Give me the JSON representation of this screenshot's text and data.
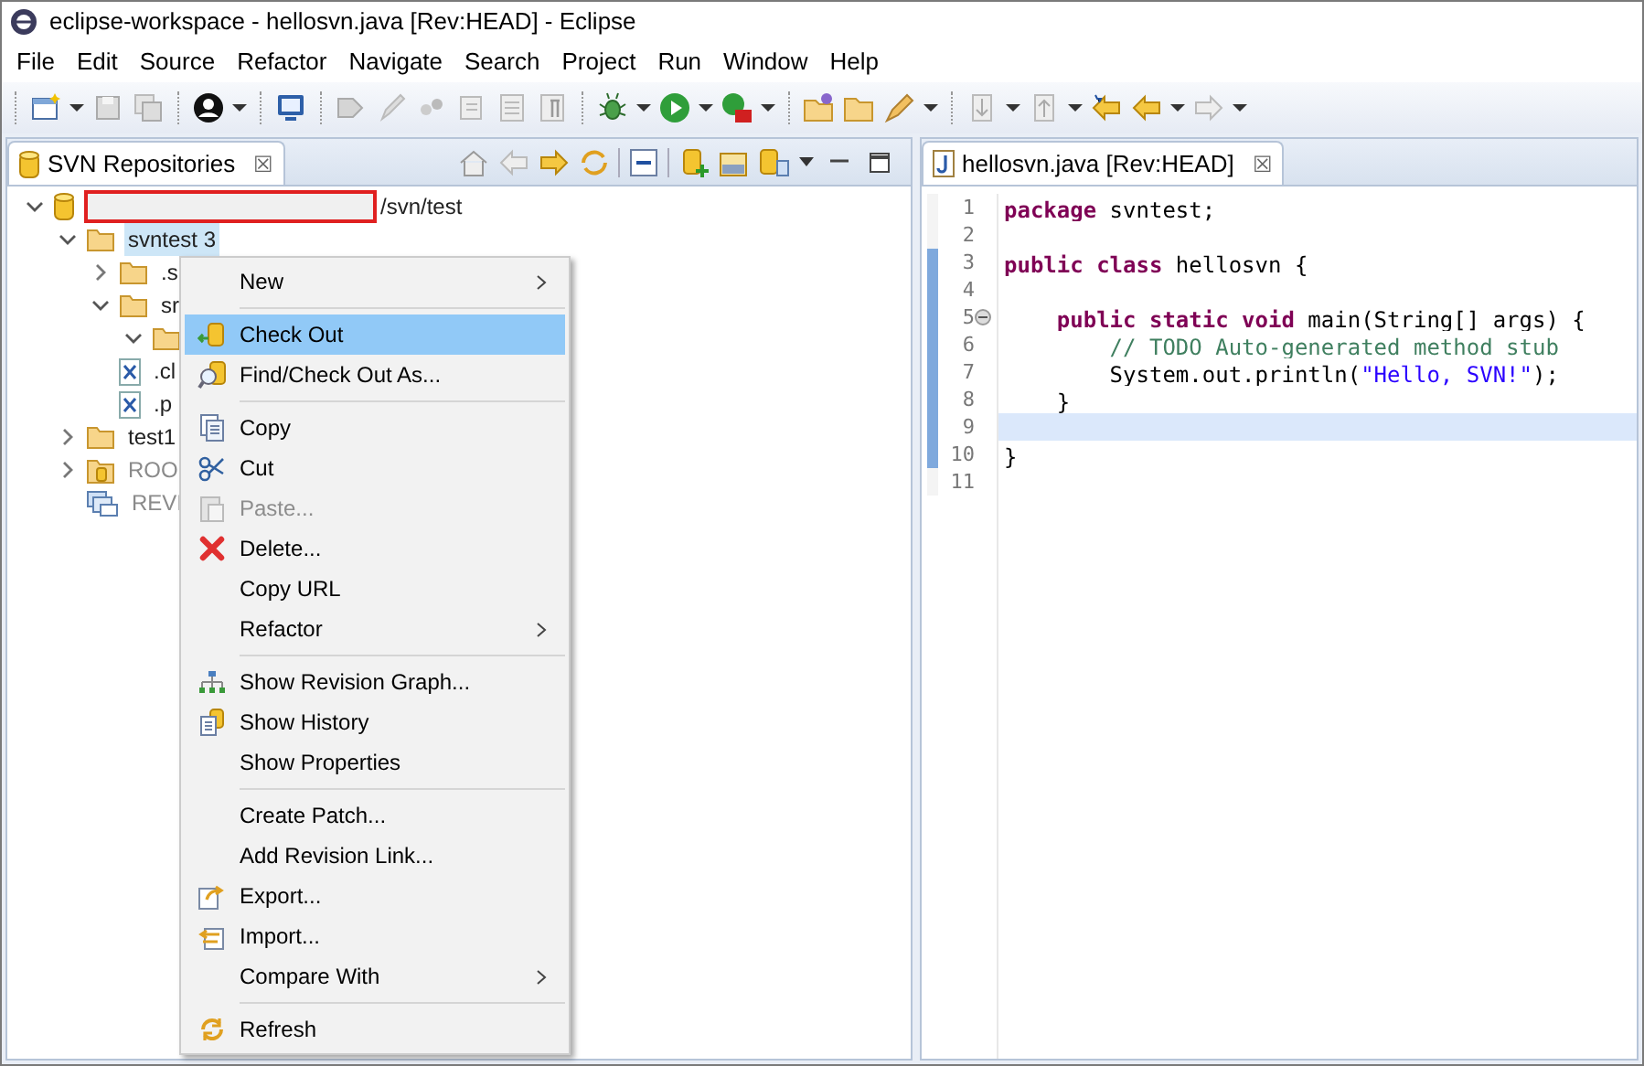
{
  "window": {
    "title": "eclipse-workspace - hellosvn.java [Rev:HEAD] - Eclipse"
  },
  "menu_bar": [
    "File",
    "Edit",
    "Source",
    "Refactor",
    "Navigate",
    "Search",
    "Project",
    "Run",
    "Window",
    "Help"
  ],
  "repositories_view": {
    "tab": {
      "label": "SVN Repositories",
      "selected": true,
      "close": "☒"
    },
    "tree": [
      {
        "kind": "repository",
        "label": "/svn/test",
        "expanded": true,
        "disabled": false,
        "children": [
          {
            "kind": "folder",
            "label": "svntest 3",
            "expanded": true,
            "selected": true,
            "disabled": false,
            "children": [
              {
                "kind": "folder",
                "label": ".s",
                "expanded": false,
                "selected": false,
                "disabled": false
              },
              {
                "kind": "folder",
                "label": "sr",
                "expanded": true,
                "selected": false,
                "disabled": false,
                "children": [
                  {
                    "kind": "folder",
                    "expanded": true
                  }
                ]
              },
              {
                "kind": "file",
                "label": ".cl",
                "selected": false,
                "disabled": false
              },
              {
                "kind": "file",
                "label": ".p",
                "selected": false,
                "disabled": false
              }
            ]
          },
          {
            "kind": "folder",
            "label": "test1",
            "expanded": false,
            "selected": false,
            "disabled": false
          },
          {
            "kind": "root",
            "label": "ROO",
            "expanded": false,
            "selected": false,
            "disabled": true
          },
          {
            "kind": "revisions",
            "label": "REVI",
            "selected": false,
            "disabled": true
          }
        ]
      }
    ]
  },
  "context_menu": [
    {
      "kind": "item",
      "label": "New",
      "submenu": true,
      "selected": false,
      "disabled": false
    },
    {
      "kind": "separator"
    },
    {
      "kind": "item",
      "label": "Check Out",
      "submenu": false,
      "selected": true,
      "disabled": false
    },
    {
      "kind": "item",
      "label": "Find/Check Out As...",
      "submenu": false,
      "selected": false,
      "disabled": false
    },
    {
      "kind": "separator"
    },
    {
      "kind": "item",
      "label": "Copy",
      "submenu": false,
      "selected": false,
      "disabled": false
    },
    {
      "kind": "item",
      "label": "Cut",
      "submenu": false,
      "selected": false,
      "disabled": false
    },
    {
      "kind": "item",
      "label": "Paste...",
      "submenu": false,
      "selected": false,
      "disabled": true
    },
    {
      "kind": "item",
      "label": "Delete...",
      "submenu": false,
      "selected": false,
      "disabled": false
    },
    {
      "kind": "item",
      "label": "Copy URL",
      "submenu": false,
      "selected": false,
      "disabled": false
    },
    {
      "kind": "item",
      "label": "Refactor",
      "submenu": true,
      "selected": false,
      "disabled": false
    },
    {
      "kind": "separator"
    },
    {
      "kind": "item",
      "label": "Show Revision Graph...",
      "submenu": false,
      "selected": false,
      "disabled": false
    },
    {
      "kind": "item",
      "label": "Show History",
      "submenu": false,
      "selected": false,
      "disabled": false
    },
    {
      "kind": "item",
      "label": "Show Properties",
      "submenu": false,
      "selected": false,
      "disabled": false
    },
    {
      "kind": "separator"
    },
    {
      "kind": "item",
      "label": "Create Patch...",
      "submenu": false,
      "selected": false,
      "disabled": false
    },
    {
      "kind": "item",
      "label": "Add Revision Link...",
      "submenu": false,
      "selected": false,
      "disabled": false
    },
    {
      "kind": "item",
      "label": "Export...",
      "submenu": false,
      "selected": false,
      "disabled": false
    },
    {
      "kind": "item",
      "label": "Import...",
      "submenu": false,
      "selected": false,
      "disabled": false
    },
    {
      "kind": "item",
      "label": "Compare With",
      "submenu": true,
      "selected": false,
      "disabled": false
    },
    {
      "kind": "separator"
    },
    {
      "kind": "item",
      "label": "Refresh",
      "submenu": false,
      "selected": false,
      "disabled": false
    }
  ],
  "editor": {
    "tab": {
      "label": "hellosvn.java [Rev:HEAD]",
      "selected": true,
      "close": "☒"
    },
    "lines": [
      {
        "number": "1",
        "changed": false,
        "current": false,
        "tokens": [
          {
            "kind": "keyword",
            "text": "package"
          },
          {
            "kind": "plain",
            "text": " svntest;"
          }
        ]
      },
      {
        "number": "2",
        "changed": false,
        "current": false
      },
      {
        "number": "3",
        "changed": true,
        "current": false,
        "tokens": [
          {
            "kind": "keyword",
            "text": "public class"
          },
          {
            "kind": "plain",
            "text": " hellosvn {"
          }
        ]
      },
      {
        "number": "4",
        "changed": true,
        "current": false
      },
      {
        "number": "5",
        "changed": true,
        "current": false,
        "folding": true,
        "tokens": [
          {
            "kind": "keyword",
            "text": "    public static void"
          },
          {
            "kind": "plain",
            "text": " main(String[] args) {"
          }
        ]
      },
      {
        "number": "6",
        "changed": true,
        "current": false,
        "tokens": [
          {
            "kind": "comment",
            "text": "        // TODO Auto-generated method stub"
          }
        ]
      },
      {
        "number": "7",
        "changed": true,
        "current": false,
        "tokens": [
          {
            "kind": "plain",
            "text": "        System.out.println("
          },
          {
            "kind": "string",
            "text": "\"Hello, SVN!\""
          },
          {
            "kind": "plain",
            "text": ");"
          }
        ]
      },
      {
        "number": "8",
        "changed": true,
        "current": false,
        "tokens": [
          {
            "kind": "plain",
            "text": "    }"
          }
        ]
      },
      {
        "number": "9",
        "changed": true,
        "current": true
      },
      {
        "number": "10",
        "changed": true,
        "current": false,
        "tokens": [
          {
            "kind": "plain",
            "text": "}"
          }
        ]
      },
      {
        "number": "11",
        "changed": false,
        "current": false
      }
    ]
  }
}
